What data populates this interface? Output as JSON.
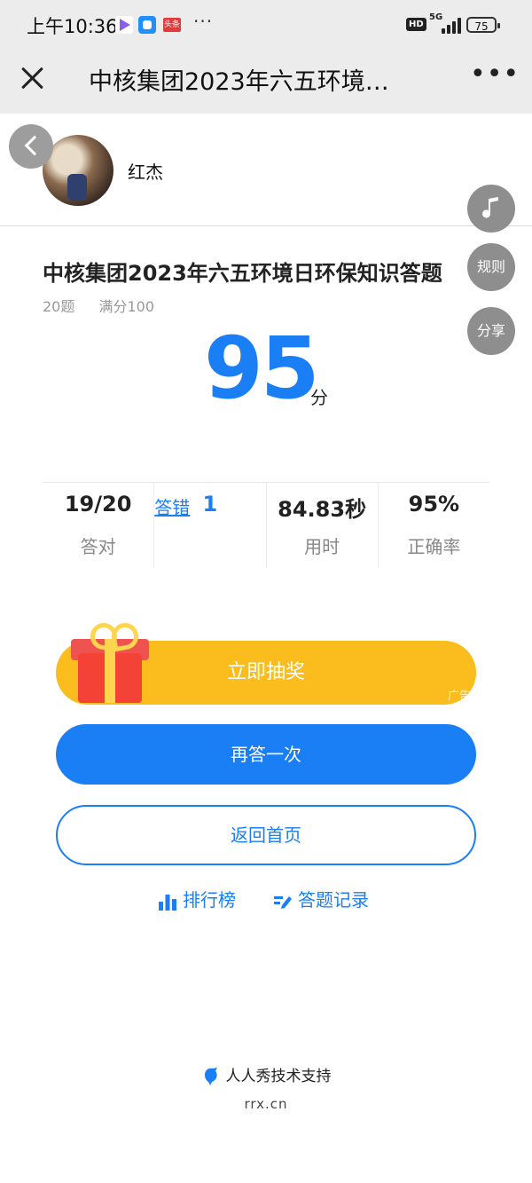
{
  "status_bar": {
    "time": "上午10:36",
    "news_badge": "头条",
    "more_dots": "···",
    "hd_label": "HD",
    "network": "5G",
    "battery": "75"
  },
  "nav": {
    "title": "中核集团2023年六五环境…",
    "more": "•••"
  },
  "profile": {
    "name": "红杰"
  },
  "side_buttons": {
    "rules": "规则",
    "share": "分享"
  },
  "quiz": {
    "title": "中核集团2023年六五环境日环保知识答题",
    "question_count": "20题",
    "full_score": "满分100",
    "score": "95",
    "score_unit": "分"
  },
  "stats": [
    {
      "value": "19/20",
      "label": "答对"
    },
    {
      "value": "1",
      "label": "答错"
    },
    {
      "value": "84.83秒",
      "label": "用时"
    },
    {
      "value": "95%",
      "label": "正确率"
    }
  ],
  "actions": {
    "lottery": "立即抽奖",
    "ad_tag": "广告",
    "retry": "再答一次",
    "home": "返回首页",
    "ranking": "排行榜",
    "records": "答题记录"
  },
  "footer": {
    "support": "人人秀技术支持",
    "url": "rrx.cn"
  },
  "colors": {
    "accent": "#1a7ef5",
    "lottery": "#fbbd1e",
    "side_button": "#8e8e8e"
  }
}
